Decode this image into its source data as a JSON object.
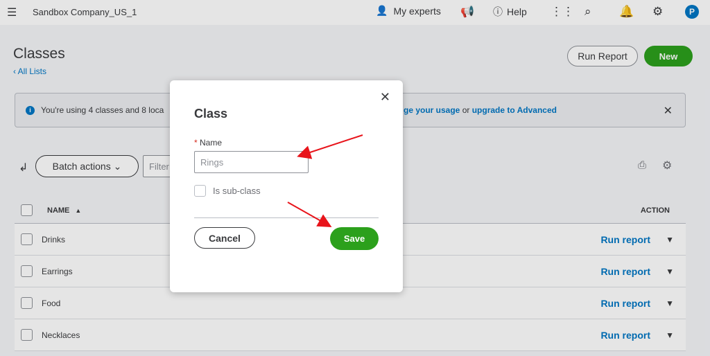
{
  "topbar": {
    "company": "Sandbox Company_US_1",
    "experts": "My experts",
    "help": "Help",
    "avatar_initial": "P"
  },
  "page": {
    "title": "Classes",
    "back_link": "All Lists",
    "run_report": "Run Report",
    "new": "New"
  },
  "banner": {
    "text": "You're using 4 classes and 8 loca",
    "link1": "ge your usage",
    "or": "or",
    "link2": "upgrade to Advanced"
  },
  "toolbar": {
    "batch_actions": "Batch actions",
    "filter_placeholder": "Filter"
  },
  "table": {
    "col_name": "NAME",
    "col_action": "ACTION",
    "rows": [
      {
        "name": "Drinks",
        "action": "Run report"
      },
      {
        "name": "Earrings",
        "action": "Run report"
      },
      {
        "name": "Food",
        "action": "Run report"
      },
      {
        "name": "Necklaces",
        "action": "Run report"
      }
    ]
  },
  "modal": {
    "title": "Class",
    "name_label": "Name",
    "name_value": "Rings",
    "subclass_label": "Is sub-class",
    "cancel": "Cancel",
    "save": "Save"
  }
}
